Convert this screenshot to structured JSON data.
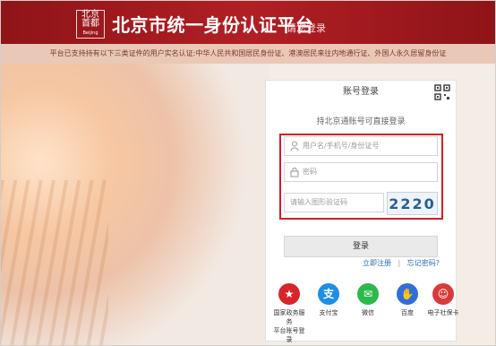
{
  "header": {
    "logo_lines": [
      "北京",
      "首都",
      "Beijing"
    ],
    "title": "北京市统一身份认证平台",
    "login_link": "请您登录"
  },
  "notice": "平台已支持持有以下三类证件的用户实名认证:中华人民共和国居民身份证、港澳居民来往内地通行证、外国人永久居留身份证",
  "login": {
    "tab_label": "账号登录",
    "hint": "持北京通账号可直接登录",
    "username_placeholder": "用户名/手机号/身份证号",
    "password_placeholder": "密码",
    "captcha_placeholder": "请输入图形验证码",
    "captcha_text": "2220",
    "login_button": "登录",
    "register_link": "立即注册",
    "forgot_link": "忘记密码?"
  },
  "providers": [
    {
      "name": "gov-platform",
      "label_line1": "国家政务服务",
      "label_line2": "平台账号登录",
      "color": "#d6262b",
      "icon": "emblem-icon"
    },
    {
      "name": "alipay",
      "label_line1": "支付宝",
      "label_line2": "",
      "color": "#1c8fe6",
      "icon": "alipay-icon"
    },
    {
      "name": "wechat",
      "label_line1": "微信",
      "label_line2": "",
      "color": "#2db84b",
      "icon": "wechat-icon"
    },
    {
      "name": "baidu",
      "label_line1": "百度",
      "label_line2": "",
      "color": "#2f6fd8",
      "icon": "baidu-icon"
    },
    {
      "name": "social-card",
      "label_line1": "电子社保卡",
      "label_line2": "",
      "color": "#d83b3b",
      "icon": "social-card-icon"
    }
  ],
  "colors": {
    "header_red": "#b11f24",
    "accent_red": "#cc1f2a",
    "link_blue": "#2a6fb3"
  }
}
